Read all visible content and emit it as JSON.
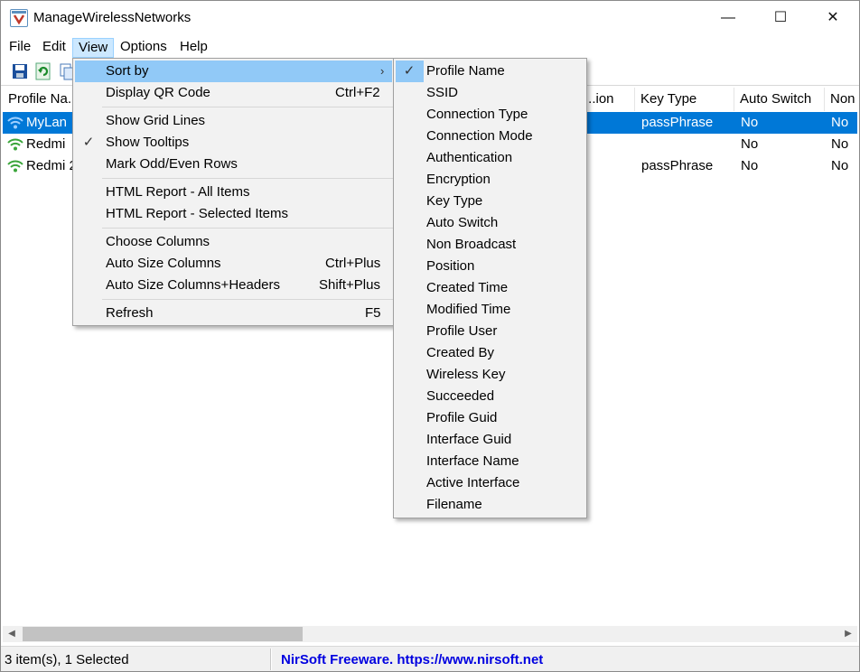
{
  "window": {
    "title": "ManageWirelessNetworks",
    "minimize": "—",
    "maximize": "☐",
    "close": "✕"
  },
  "menubar": [
    "File",
    "Edit",
    "View",
    "Options",
    "Help"
  ],
  "columns": [
    "Profile Na...",
    "...ion",
    "Key Type",
    "Auto Switch",
    "Non"
  ],
  "rows": [
    {
      "name": "MyLan",
      "key_type": "passPhrase",
      "auto_switch": "No",
      "non": "No",
      "selected": true
    },
    {
      "name": "Redmi",
      "key_type": "",
      "auto_switch": "No",
      "non": "No",
      "selected": false
    },
    {
      "name": "Redmi 2",
      "key_type": "passPhrase",
      "auto_switch": "No",
      "non": "No",
      "selected": false
    }
  ],
  "view_menu": {
    "sort_by": "Sort by",
    "display_qr": "Display QR Code",
    "display_qr_sc": "Ctrl+F2",
    "grid_lines": "Show Grid Lines",
    "tooltips": "Show Tooltips",
    "odd_even": "Mark Odd/Even Rows",
    "html_all": "HTML Report - All Items",
    "html_selected": "HTML Report - Selected Items",
    "choose_columns": "Choose Columns",
    "auto_size": "Auto Size Columns",
    "auto_size_sc": "Ctrl+Plus",
    "auto_size_headers": "Auto Size Columns+Headers",
    "auto_size_headers_sc": "Shift+Plus",
    "refresh": "Refresh",
    "refresh_sc": "F5"
  },
  "sort_menu": [
    "Profile Name",
    "SSID",
    "Connection Type",
    "Connection Mode",
    "Authentication",
    "Encryption",
    "Key Type",
    "Auto Switch",
    "Non Broadcast",
    "Position",
    "Created Time",
    "Modified Time",
    "Profile User",
    "Created By",
    "Wireless Key",
    "Succeeded",
    "Profile Guid",
    "Interface Guid",
    "Interface Name",
    "Active Interface",
    "Filename"
  ],
  "status": {
    "count": "3 item(s), 1 Selected",
    "credit": "NirSoft Freeware. https://www.nirsoft.net"
  },
  "colors": {
    "selection": "#0078d7",
    "menu_highlight": "#91c9f7",
    "credit": "#0000e0"
  }
}
